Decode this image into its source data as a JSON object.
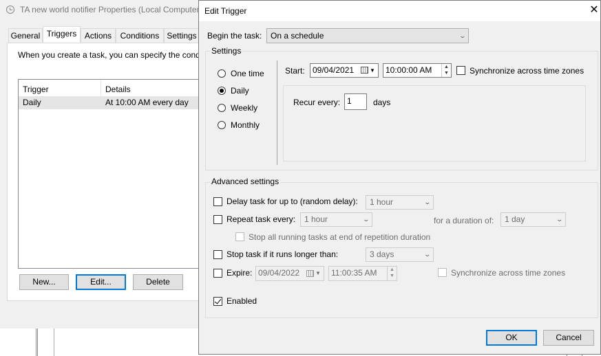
{
  "background_window": {
    "title": "TA new world notifier Properties (Local Computer",
    "tabs": [
      "General",
      "Triggers",
      "Actions",
      "Conditions",
      "Settings"
    ],
    "intro": "When you create a task, you can specify the condi",
    "list_headers": [
      "Trigger",
      "Details"
    ],
    "rows": [
      {
        "trigger": "Daily",
        "details": "At 10:00 AM every day"
      }
    ],
    "buttons": {
      "new": "New...",
      "edit": "Edit...",
      "delete": "Delete"
    }
  },
  "dialog": {
    "title": "Edit Trigger",
    "close_icon": "close-icon",
    "begin_label": "Begin the task:",
    "begin_value": "On a schedule",
    "settings": {
      "group_label": "Settings",
      "radios": [
        "One time",
        "Daily",
        "Weekly",
        "Monthly"
      ],
      "selected_radio": "Daily",
      "start_label": "Start:",
      "start_date": "09/04/2021",
      "start_time": "10:00:00 AM",
      "sync_label": "Synchronize across time zones",
      "recur_label": "Recur every:",
      "recur_value": "1",
      "recur_unit": "days"
    },
    "advanced": {
      "group_label": "Advanced settings",
      "delay_label": "Delay task for up to (random delay):",
      "delay_value": "1 hour",
      "repeat_label": "Repeat task every:",
      "repeat_value": "1 hour",
      "duration_label": "for a duration of:",
      "duration_value": "1 day",
      "stop_running_label": "Stop all running tasks at end of repetition duration",
      "stop_longer_label": "Stop task if it runs longer than:",
      "stop_longer_value": "3 days",
      "expire_label": "Expire:",
      "expire_date": "09/04/2022",
      "expire_time": "11:00:35 AM",
      "expire_sync_label": "Synchronize across time zones",
      "enabled_label": "Enabled",
      "enabled_checked": true
    },
    "buttons": {
      "ok": "OK",
      "cancel": "Cancel"
    }
  },
  "colors": {
    "accent": "#0078d7",
    "dialog_bg": "#f0f0f0"
  }
}
